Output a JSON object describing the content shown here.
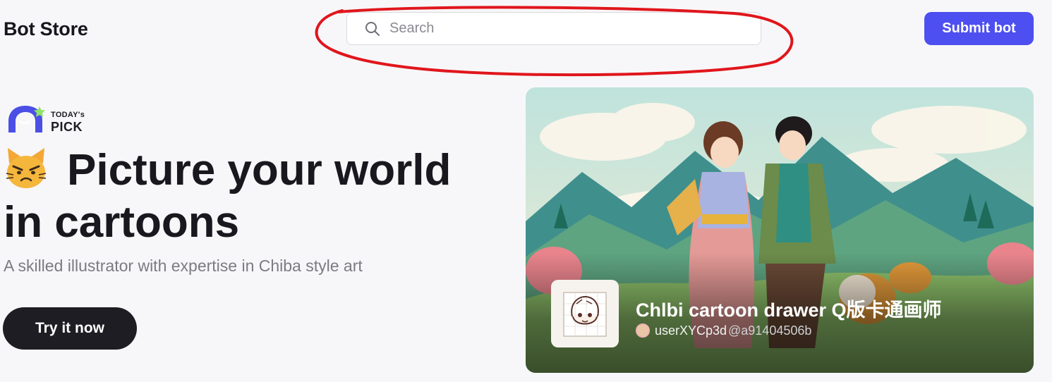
{
  "header": {
    "brand": "Bot Store",
    "search_placeholder": "Search",
    "submit_label": "Submit bot"
  },
  "hero": {
    "badge_line1": "TODAY's",
    "badge_line2": "PICK",
    "headline": "Picture your world in cartoons",
    "subtitle": "A skilled illustrator with expertise in Chiba style art",
    "cta_label": "Try it now"
  },
  "featured": {
    "bot_name": "Chlbi cartoon drawer Q版卡通画师",
    "author_name": "userXYCp3d",
    "author_handle": "@a91404506b"
  },
  "icons": {
    "search": "search-icon",
    "cat": "angry-cat-emoji-icon",
    "badge": "todays-pick-logo-icon"
  },
  "colors": {
    "accent": "#4d4ff0",
    "cta": "#1e1d23",
    "annotation": "#e0161c"
  }
}
